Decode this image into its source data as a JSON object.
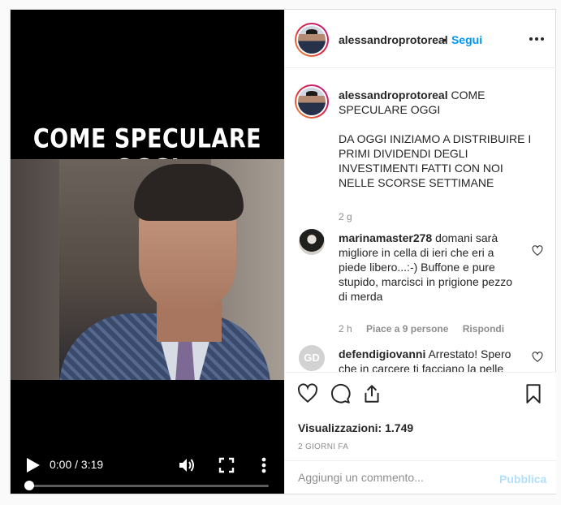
{
  "video": {
    "overlay_title": "COME SPECULARE OGGI",
    "time_display": "0:00 / 3:19",
    "progress": 0
  },
  "post": {
    "username": "alessandroprotoreal",
    "separator": "•",
    "follow_label": "Segui",
    "caption_title": "COME SPECULARE OGGI",
    "caption_body": "DA OGGI INIZIAMO A DISTRIBUIRE I PRIMI DIVIDENDI DEGLI INVESTIMENTI FATTI CON NOI NELLE SCORSE SETTIMANE",
    "caption_age": "2 g",
    "views_label": "Visualizzazioni:",
    "views_count": "1.749",
    "date_label": "2 GIORNI FA",
    "comment_placeholder": "Aggiungi un commento...",
    "publish_label": "Pubblica"
  },
  "comments": [
    {
      "username": "marinamaster278",
      "text": "domani sarà migliore in cella di ieri che eri a piede libero...:-) Buffone e pure stupido, marcisci in prigione pezzo di merda",
      "age": "2 h",
      "likes": "Piace a 9 persone",
      "reply": "Rispondi"
    },
    {
      "username": "defendigiovanni",
      "avatar_initials": "GD",
      "text": "Arrestato! Spero che in carcere ti facciano la pelle"
    }
  ],
  "icons": {
    "like": "heart-icon",
    "comment": "comment-icon",
    "share": "share-icon",
    "save": "bookmark-icon",
    "more": "more-horizontal-icon",
    "play": "play-icon",
    "volume": "volume-icon",
    "fullscreen": "fullscreen-icon",
    "video_more": "more-vertical-icon"
  },
  "colors": {
    "accent": "#0095f6",
    "publish_disabled": "#b2dffc",
    "secondary_text": "#8e8e8e"
  }
}
